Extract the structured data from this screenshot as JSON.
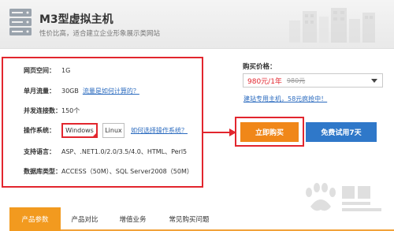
{
  "header": {
    "title": "M3型虚拟主机",
    "subtitle": "性价比高，适合建立企业形象展示类网站",
    "watermark_text": "Baidu 经验",
    "icon": "server-icon"
  },
  "specs": {
    "space": {
      "label": "网页空间：",
      "value": "1G"
    },
    "traffic": {
      "label": "单月流量：",
      "value": "30GB",
      "link": "流量是如何计算的？"
    },
    "concurrency": {
      "label": "并发连接数：",
      "value": "150个"
    },
    "os": {
      "label": "操作系统：",
      "options": [
        "Windows",
        "Linux"
      ],
      "selected": "Windows",
      "link": "如何选择操作系统？"
    },
    "languages": {
      "label": "支持语言：",
      "value": "ASP、.NET1.0/2.0/3.5/4.0、HTML、Perl5"
    },
    "database": {
      "label": "数据库类型：",
      "value": "ACCESS（50M）、SQL Server2008（50M）"
    }
  },
  "purchase": {
    "price_label": "购买价格：",
    "price_current": "980元/1年",
    "price_old": "980元",
    "promo_link": "建站专用主机，58元疯抢中！",
    "buy_label": "立即购买",
    "trial_label": "免费试用7天"
  },
  "tabs": [
    "产品参数",
    "产品对比",
    "增值业务",
    "常见购买问题"
  ],
  "active_tab": "产品参数",
  "colors": {
    "accent_red": "#e2262e",
    "orange": "#f08719",
    "blue": "#2f78c9",
    "link": "#2b6bbf"
  }
}
